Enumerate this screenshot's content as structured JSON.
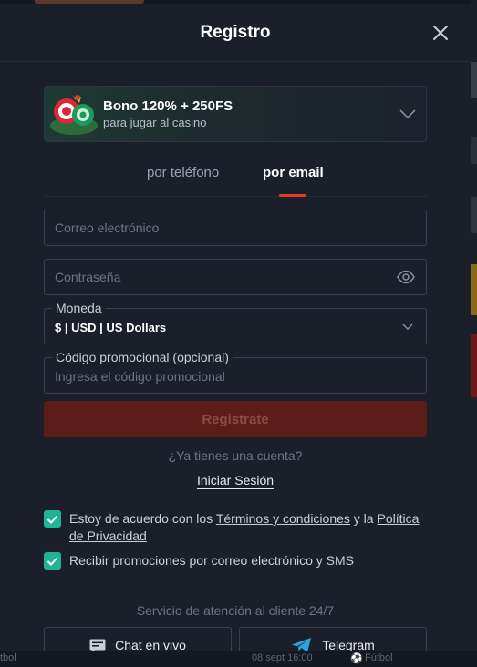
{
  "modal": {
    "title": "Registro",
    "bonus": {
      "title": "Bono 120% + 250FS",
      "subtitle": "para jugar al casino"
    },
    "tabs": [
      {
        "label": "por teléfono",
        "active": false
      },
      {
        "label": "por email",
        "active": true
      }
    ],
    "email": {
      "placeholder": "Correo electrónico",
      "value": ""
    },
    "password": {
      "placeholder": "Contraseña",
      "value": ""
    },
    "currency": {
      "label": "Moneda",
      "value": "$ | USD | US Dollars"
    },
    "promo": {
      "label": "Código promocional (opcional)",
      "placeholder": "Ingresa el código promocional",
      "value": ""
    },
    "register_label": "Registrate",
    "have_account": "¿Ya tienes una cuenta?",
    "login_label": "Iniciar Sesión",
    "terms": {
      "prefix": "Estoy de acuerdo con los ",
      "terms_link": "Términos y condiciones",
      "middle": " y la ",
      "privacy_link": "Política de Privacidad",
      "checked": true
    },
    "promos_consent": {
      "label": "Recibir promociones por correo electrónico y SMS",
      "checked": true
    },
    "support": {
      "title": "Servicio de atención al cliente 24/7",
      "chat_label": "Chat en vivo",
      "telegram_label": "Telegram"
    }
  },
  "bottom_bar": {
    "left": "tbol",
    "date": "08 sept 16:00",
    "sport": "Fútbol"
  },
  "colors": {
    "accent_red": "#e23a2a",
    "checkbox_green": "#1eb495",
    "register_disabled_bg": "#5a1d17",
    "telegram_blue": "#2aa3e0"
  },
  "icons": [
    "close-icon",
    "chevron-down-icon",
    "eye-icon",
    "check-icon",
    "chat-icon",
    "telegram-icon",
    "football-icon"
  ]
}
